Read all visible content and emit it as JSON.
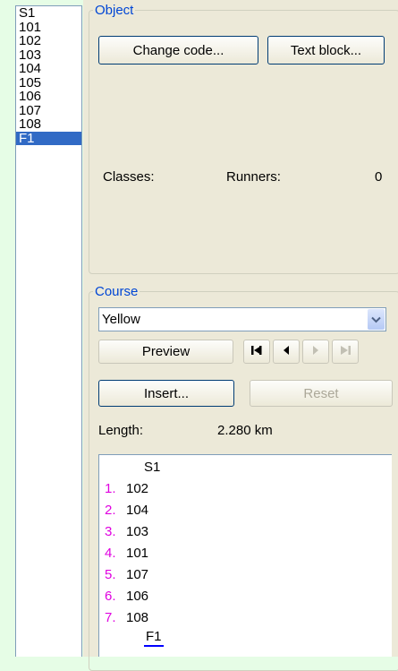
{
  "control_list": {
    "items": [
      "S1",
      "101",
      "102",
      "103",
      "104",
      "105",
      "106",
      "107",
      "108",
      "F1"
    ],
    "selected": "F1"
  },
  "object_group": {
    "legend": "Object",
    "change_code_label": "Change code...",
    "text_block_label": "Text block...",
    "classes_label": "Classes:",
    "runners_label": "Runners:",
    "runners_value": "0"
  },
  "course_group": {
    "legend": "Course",
    "selected_course": "Yellow",
    "preview_label": "Preview",
    "insert_label": "Insert...",
    "reset_label": "Reset",
    "length_label": "Length:",
    "length_value": "2.280 km"
  },
  "sequence": {
    "start": "S1",
    "controls": [
      {
        "num": "1.",
        "code": "102"
      },
      {
        "num": "2.",
        "code": "104"
      },
      {
        "num": "3.",
        "code": "103"
      },
      {
        "num": "4.",
        "code": "101"
      },
      {
        "num": "5.",
        "code": "107"
      },
      {
        "num": "6.",
        "code": "106"
      },
      {
        "num": "7.",
        "code": "108"
      }
    ],
    "finish": "F1"
  },
  "colors": {
    "background": "#e6fde6",
    "selection": "#316ac5",
    "legend_text": "#0046d5",
    "sequence_number": "#e000e0",
    "finish_underline": "#0000ff"
  },
  "icons": [
    "chevron-down-icon",
    "first-control-icon",
    "previous-control-icon",
    "next-control-icon",
    "last-control-icon"
  ]
}
